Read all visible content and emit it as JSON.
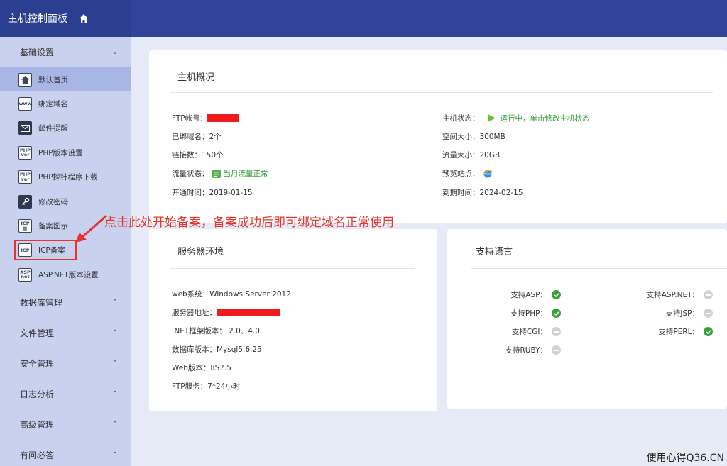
{
  "sidebar": {
    "brand": "主机控制面板",
    "group_basic": "基础设置",
    "items": [
      {
        "label": "默认首页",
        "icon": "home-icon"
      },
      {
        "label": "绑定域名",
        "icon": "www-icon"
      },
      {
        "label": "邮件提醒",
        "icon": "mail-icon"
      },
      {
        "label": "PHP版本设置",
        "icon": "php-icon"
      },
      {
        "label": "PHP探针程序下载",
        "icon": "php-icon"
      },
      {
        "label": "修改密码",
        "icon": "key-icon"
      },
      {
        "label": "备案图示",
        "icon": "icp-badge-icon"
      },
      {
        "label": "ICP备案",
        "icon": "icp-icon"
      },
      {
        "label": "ASP.NET版本设置",
        "icon": "asp-icon"
      }
    ],
    "groups": [
      "数据库管理",
      "文件管理",
      "安全管理",
      "日志分析",
      "高级管理",
      "有问必答"
    ]
  },
  "overview": {
    "title": "主机概况",
    "ftp_label": "FTP帐号：",
    "bound_domains": "已绑域名：2个",
    "connections": "链接数：150个",
    "traffic_status_label": "流量状态：",
    "traffic_status_value": "当月流量正常",
    "open_time": "开通时间：2019-01-15",
    "host_status_label": "主机状态：",
    "host_status_value": "运行中，单击修改主机状态",
    "space_size": "空间大小：300MB",
    "traffic_size": "流量大小：20GB",
    "preview_label": "预览站点：",
    "expire_time": "到期时间：2024-02-15"
  },
  "server_env": {
    "title": "服务器环境",
    "web_system": "web系统：Windows Server 2012",
    "server_address_label": "服务器地址：",
    "dotnet": ".NET框架版本： 2.0、4.0",
    "database": "数据库版本：Mysql5.6.25",
    "web_version": "Web版本：IIS7.5",
    "ftp_service": "FTP服务：7*24小时"
  },
  "languages": {
    "title": "支持语言",
    "left": [
      {
        "label": "支持ASP：",
        "supported": true
      },
      {
        "label": "支持PHP：",
        "supported": true
      },
      {
        "label": "支持CGI：",
        "supported": false
      },
      {
        "label": "支持RUBY：",
        "supported": false
      }
    ],
    "right": [
      {
        "label": "支持ASP.NET：",
        "supported": false
      },
      {
        "label": "支持JSP：",
        "supported": false
      },
      {
        "label": "支持PERL：",
        "supported": true
      }
    ]
  },
  "annotation": "点击此处开始备案，备案成功后即可绑定域名正常使用",
  "watermark": "使用心得Q36.CN",
  "colors": {
    "topbar": "#2f449a",
    "sidebar": "#c8d2ef",
    "active": "#a8b6e6",
    "annotation": "#e5352c",
    "ok_green": "#3aa13a"
  }
}
